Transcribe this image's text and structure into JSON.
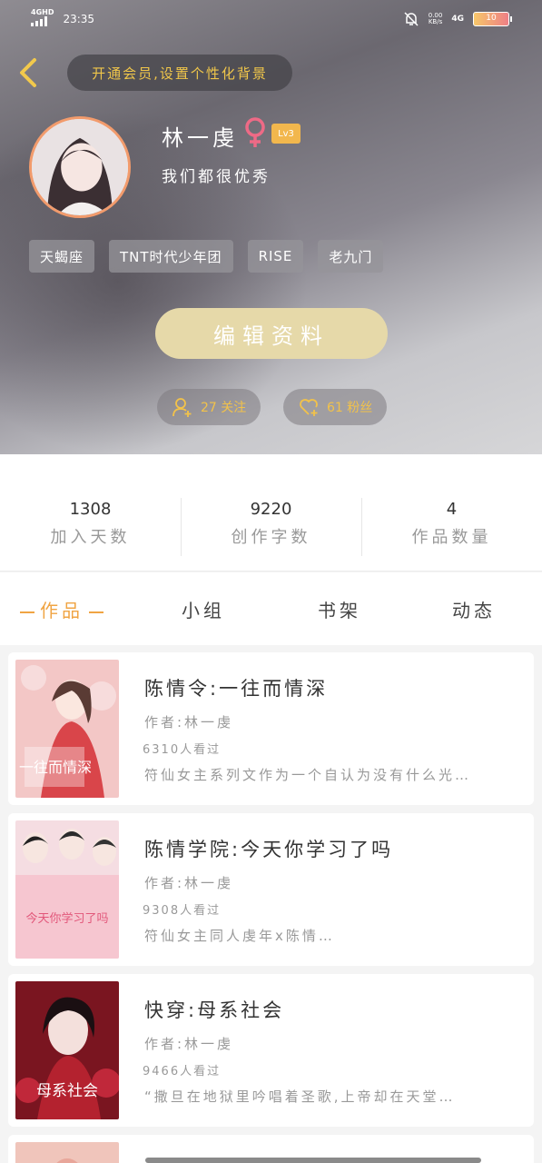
{
  "status_bar": {
    "network_label": "4GHD",
    "time": "23:35",
    "speed_top": "0.00",
    "speed_bottom": "KB/s",
    "network_right": "4G",
    "battery": "10"
  },
  "header": {
    "vip_prompt": "开通会员,设置个性化背景",
    "username": "林一虔",
    "level": "Lv3",
    "signature": "我们都很优秀",
    "tags": [
      "天蝎座",
      "TNT时代少年团",
      "RISE",
      "老九门"
    ],
    "edit_button": "编辑资料",
    "following": "27 关注",
    "fans": "61 粉丝"
  },
  "stats": [
    {
      "value": "1308",
      "label": "加入天数"
    },
    {
      "value": "9220",
      "label": "创作字数"
    },
    {
      "value": "4",
      "label": "作品数量"
    }
  ],
  "tabs": [
    {
      "label": "作品",
      "active": true
    },
    {
      "label": "小组",
      "active": false
    },
    {
      "label": "书架",
      "active": false
    },
    {
      "label": "动态",
      "active": false
    }
  ],
  "works": [
    {
      "title": "陈情令:一往而情深",
      "author": "作者:林一虔",
      "views": "6310人看过",
      "desc": "符仙女主系列文作为一个自认为没有什么光…",
      "cover_text": "一往而情深"
    },
    {
      "title": "陈情学院:今天你学习了吗",
      "author": "作者:林一虔",
      "views": "9308人看过",
      "desc": "符仙女主同人虔年x陈情…",
      "cover_text": "今天你学习了吗"
    },
    {
      "title": "快穿:母系社会",
      "author": "作者:林一虔",
      "views": "9466人看过",
      "desc": "“撒旦在地狱里吟唱着圣歌,上帝却在天堂…",
      "cover_text": "母系社会"
    }
  ],
  "colors": {
    "accent": "#f0a443",
    "vip_gold": "#f0c64a",
    "edit_button": "#e6d9a9",
    "avatar_border": "#f29b6c",
    "gender": "#ee6a86"
  }
}
